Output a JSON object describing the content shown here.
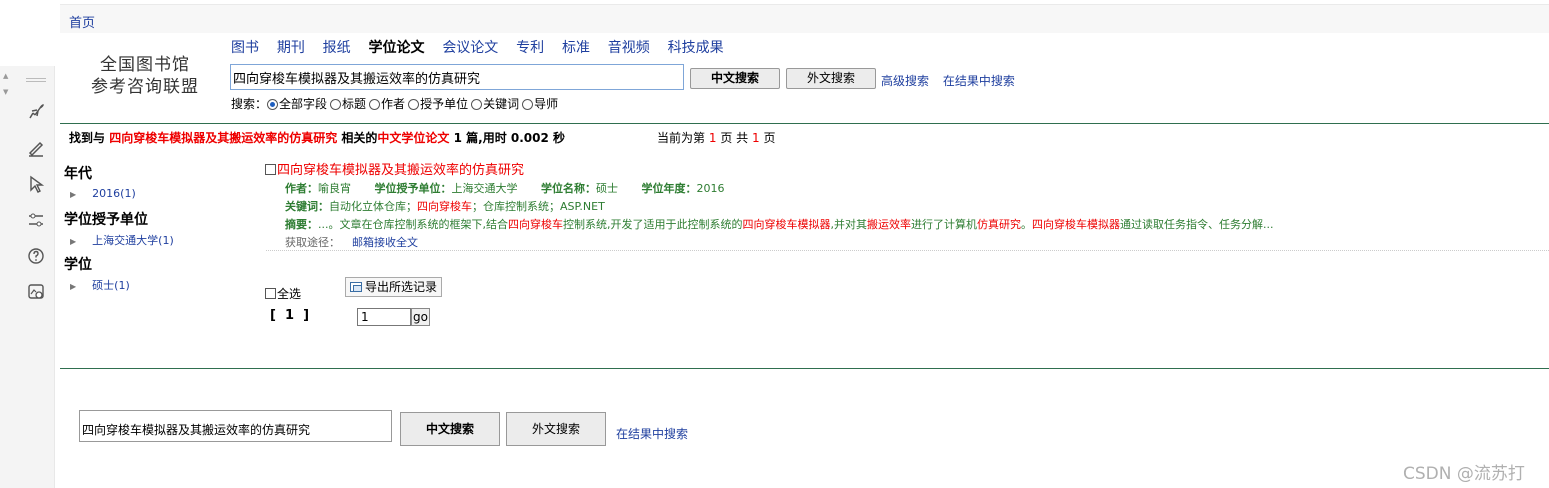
{
  "breadcrumb": {
    "home": "首页"
  },
  "logo": {
    "line1": "全国图书馆",
    "line2": "参考咨询联盟"
  },
  "nav_tabs": [
    {
      "label": "图书",
      "active": false
    },
    {
      "label": "期刊",
      "active": false
    },
    {
      "label": "报纸",
      "active": false
    },
    {
      "label": "学位论文",
      "active": true
    },
    {
      "label": "会议论文",
      "active": false
    },
    {
      "label": "专利",
      "active": false
    },
    {
      "label": "标准",
      "active": false
    },
    {
      "label": "音视频",
      "active": false
    },
    {
      "label": "科技成果",
      "active": false
    }
  ],
  "search": {
    "value": "四向穿梭车模拟器及其搬运效率的仿真研究",
    "btn_cn": "中文搜索",
    "btn_foreign": "外文搜索",
    "advanced": "高级搜索",
    "in_results": "在结果中搜索",
    "field_label": "搜索：",
    "fields": [
      {
        "label": "全部字段",
        "checked": true
      },
      {
        "label": "标题",
        "checked": false
      },
      {
        "label": "作者",
        "checked": false
      },
      {
        "label": "授予单位",
        "checked": false
      },
      {
        "label": "关键词",
        "checked": false
      },
      {
        "label": "导师",
        "checked": false
      }
    ]
  },
  "summary": {
    "prefix": "找到与",
    "query": "四向穿梭车模拟器及其搬运效率的仿真研究",
    "mid": "相关的",
    "type": "中文学位论文",
    "count_text": "1 篇,用时 0.002 秒",
    "page_prefix": "当前为第",
    "page_current": "1",
    "page_mid": "页 共",
    "page_total": "1",
    "page_suffix": "页"
  },
  "facets": {
    "year": {
      "title": "年代",
      "items": [
        "2016(1)"
      ]
    },
    "unit": {
      "title": "学位授予单位",
      "items": [
        "上海交通大学(1)"
      ]
    },
    "degree": {
      "title": "学位",
      "items": [
        "硕士(1)"
      ]
    }
  },
  "record": {
    "title": "四向穿梭车模拟器及其搬运效率的仿真研究",
    "author_label": "作者：",
    "author": "喻良宵",
    "unit_label": "学位授予单位：",
    "unit": "上海交通大学",
    "degree_label": "学位名称：",
    "degree": "硕士",
    "year_label": "学位年度：",
    "year": "2016",
    "kw_label": "关键词：",
    "keywords": [
      {
        "text": "自动化立体仓库",
        "hl": false
      },
      {
        "text": "；",
        "hl": false
      },
      {
        "text": "四向穿梭车",
        "hl": true
      },
      {
        "text": "；仓库控制系统；ASP.NET",
        "hl": false
      }
    ],
    "abs_label": "摘要：",
    "abstract": [
      {
        "text": "...。文章在仓库控制系统的框架下,结合",
        "hl": false
      },
      {
        "text": "四向穿梭车",
        "hl": true
      },
      {
        "text": "控制系统,开发了适用于此控制系统的",
        "hl": false
      },
      {
        "text": "四向穿梭车模拟器",
        "hl": true
      },
      {
        "text": ",并对其",
        "hl": false
      },
      {
        "text": "搬运效率",
        "hl": true
      },
      {
        "text": "进行了计算机",
        "hl": false
      },
      {
        "text": "仿真研究",
        "hl": true
      },
      {
        "text": "。",
        "hl": false
      },
      {
        "text": "四向穿梭车模拟器",
        "hl": true
      },
      {
        "text": "通过读取任务指令、任务分解...",
        "hl": false
      }
    ],
    "access_label": "获取途径：",
    "access_link": "邮箱接收全文"
  },
  "list_actions": {
    "select_all": "全选",
    "export": "导出所选记录",
    "pager": "[  1  ]",
    "page_input": "1",
    "go": "go"
  },
  "bottom_search": {
    "value": "四向穿梭车模拟器及其搬运效率的仿真研究",
    "btn_cn": "中文搜索",
    "btn_foreign": "外文搜索",
    "in_results": "在结果中搜索"
  },
  "watermark": "CSDN @流苏打",
  "colors": {
    "link": "#1f3f9f",
    "highlight": "#e00000",
    "meta_green": "#2e7d32",
    "rule_green": "#2f6f4f"
  }
}
